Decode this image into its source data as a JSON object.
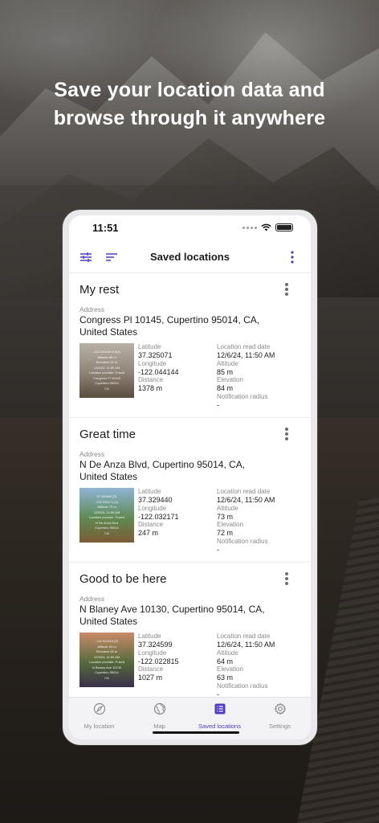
{
  "headline": {
    "line1": "Save your location data and",
    "line2": "browse through it anywhere"
  },
  "status": {
    "time": "11:51"
  },
  "appbar": {
    "title": "Saved locations"
  },
  "labels": {
    "address": "Address",
    "latitude": "Latitude",
    "longitude": "Longitude",
    "distance": "Distance",
    "read_date": "Location read date",
    "altitude": "Altitude",
    "elevation": "Elevation",
    "notif": "Notification radius"
  },
  "locations": [
    {
      "name": "My rest",
      "address": "Congress Pl 10145, Cupertino 95014, CA, United States",
      "latitude": "37.325071",
      "longitude": "-122.044144",
      "distance": "1378 m",
      "read_date": "12/6/24, 11:50 AM",
      "altitude": "85 m",
      "elevation": "84 m",
      "notif": "-",
      "thumb_lines": [
        "-122.044144,6.6(4)",
        "Altitude 85 m",
        "Elevation 84 m",
        "12/6/24, 11:50 AM",
        "Location provider: Fused",
        "Congress Pl 10145",
        "Cupertino 95014",
        "CA"
      ],
      "thumb_colors": [
        "#b9b0a6",
        "#8e8376",
        "#5a4d3e"
      ]
    },
    {
      "name": "Great time",
      "address": "N De Anza Blvd, Cupertino 95014, CA, United States",
      "latitude": "37.329440",
      "longitude": "-122.032171",
      "distance": "247 m",
      "read_date": "12/6/24, 11:50 AM",
      "altitude": "73 m",
      "elevation": "72 m",
      "notif": "-",
      "thumb_lines": [
        "37.329440,(2)",
        "-122.032171,(2)",
        "Altitude 73 m",
        "12/6/24, 11:50 AM",
        "Location provider: Fused",
        "N De Anza Blvd",
        "Cupertino 95014",
        "CA"
      ],
      "thumb_colors": [
        "#8fb5d6",
        "#5f8a52",
        "#7c5b35"
      ]
    },
    {
      "name": "Good to be here",
      "address": "N Blaney Ave 10130, Cupertino 95014, CA, United States",
      "latitude": "37.324599",
      "longitude": "-122.022815",
      "distance": "1027 m",
      "read_date": "12/6/24, 11:50 AM",
      "altitude": "64 m",
      "elevation": "63 m",
      "notif": "-",
      "thumb_lines": [
        "-122.022815,(2)",
        "Altitude 64 m",
        "Elevation 63 m",
        "12/6/24, 11:50 AM",
        "Location provider: Fused",
        "N Blaney Ave 10130",
        "Cupertino 95014",
        "CA"
      ],
      "thumb_colors": [
        "#c98a6a",
        "#556b3a",
        "#3b2f4a"
      ]
    }
  ],
  "nav": [
    {
      "label": "My location",
      "icon": "compass-icon",
      "active": false
    },
    {
      "label": "Map",
      "icon": "globe-icon",
      "active": false
    },
    {
      "label": "Saved locations",
      "icon": "list-icon",
      "active": true
    },
    {
      "label": "Settings",
      "icon": "gear-icon",
      "active": false
    }
  ],
  "colors": {
    "accent": "#4e3bc4"
  }
}
